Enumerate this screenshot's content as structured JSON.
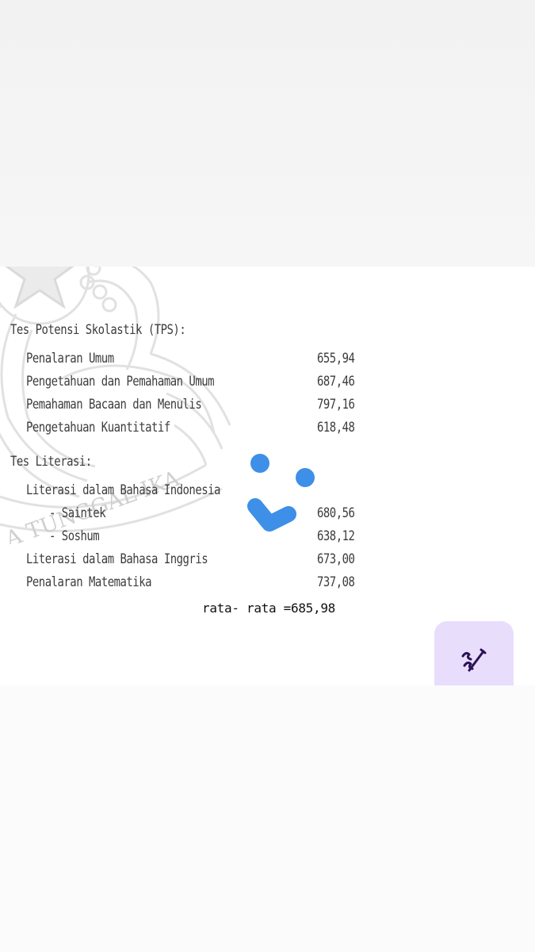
{
  "document": {
    "tps_heading": "Tes Potensi Skolastik (TPS):",
    "tps_items": [
      {
        "label": "Penalaran Umum",
        "value": "655,94"
      },
      {
        "label": "Pengetahuan dan Pemahaman Umum",
        "value": "687,46"
      },
      {
        "label": "Pemahaman Bacaan dan Menulis",
        "value": "797,16"
      },
      {
        "label": "Pengetahuan Kuantitatif",
        "value": "618,48"
      }
    ],
    "literasi_heading": "Tes Literasi:",
    "literasi_indo_label": "Literasi dalam Bahasa Indonesia",
    "saintek": {
      "label": "- Saintek",
      "value": "680,56"
    },
    "soshum": {
      "label": "- Soshum",
      "value": "638,12"
    },
    "literasi_inggris": {
      "label": "Literasi dalam Bahasa Inggris",
      "value": "673,00"
    },
    "penalaran_matematika": {
      "label": "Penalaran Matematika",
      "value": "737,08"
    },
    "watermark_text": "A TUNGGAL IKA"
  },
  "annotation": {
    "average_text": "rata- rata =685,98"
  },
  "icons": {
    "loading": "loading-spinner-icon",
    "fab": "magic-edit-icon"
  },
  "colors": {
    "spinner": "#3d8fe8",
    "fab_bg": "#e9ddfc",
    "fab_icon": "#2a1257"
  }
}
